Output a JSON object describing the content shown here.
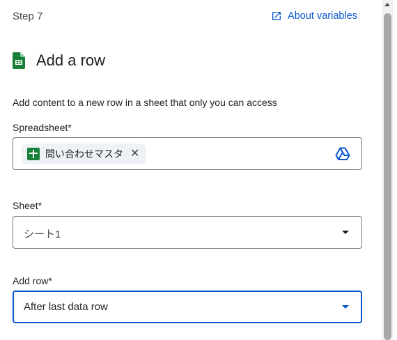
{
  "step": {
    "label": "Step 7"
  },
  "help": {
    "about_variables": "About variables"
  },
  "action": {
    "title": "Add a row",
    "icon": "google-sheets-icon",
    "description": "Add content to a new row in a sheet that only you can access"
  },
  "fields": {
    "spreadsheet": {
      "label": "Spreadsheet*",
      "chip_text": "問い合わせマスタ",
      "chip_icon": "google-sheets-icon",
      "picker_icon": "google-drive-icon"
    },
    "sheet": {
      "label": "Sheet*",
      "value": "シート1"
    },
    "add_row": {
      "label": "Add row*",
      "value": "After last data row"
    }
  },
  "colors": {
    "accent": "#0b57d0",
    "sheets_green": "#188038",
    "border": "#747775"
  }
}
